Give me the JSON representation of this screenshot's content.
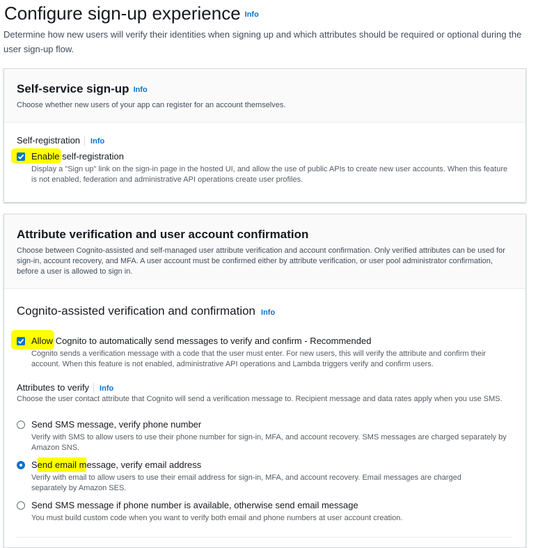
{
  "header": {
    "title": "Configure sign-up experience",
    "info": "Info",
    "description": "Determine how new users will verify their identities when signing up and which attributes should be required or optional during the user sign-up flow."
  },
  "self_service": {
    "title": "Self-service sign-up",
    "info": "Info",
    "description": "Choose whether new users of your app can register for an account themselves.",
    "field_label": "Self-registration",
    "field_info": "Info",
    "checkbox": {
      "label_highlight": "Enable",
      "label_rest": " self-registration",
      "checked": true,
      "description": "Display a \"Sign up\" link on the sign-in page in the hosted UI, and allow the use of public APIs to create new user accounts. When this feature is not enabled, federation and administrative API operations create user profiles."
    }
  },
  "attribute_verification": {
    "title": "Attribute verification and user account confirmation",
    "description": "Choose between Cognito-assisted and self-managed user attribute verification and account confirmation. Only verified attributes can be used for sign-in, account recovery, and MFA. A user account must be confirmed either by attribute verification, or user pool administrator confirmation, before a user is allowed to sign in.",
    "cognito_section": {
      "title": "Cognito-assisted verification and confirmation",
      "info": "Info",
      "checkbox": {
        "label_highlight": "Allow",
        "label_rest": " Cognito to automatically send messages to verify and confirm - Recommended",
        "checked": true,
        "description": "Cognito sends a verification message with a code that the user must enter. For new users, this will verify the attribute and confirm their account. When this feature is not enabled, administrative API operations and Lambda triggers verify and confirm users."
      },
      "attributes_label": "Attributes to verify",
      "attributes_info": "Info",
      "attributes_description": "Choose the user contact attribute that Cognito will send a verification message to. Recipient message and data rates apply when you use SMS.",
      "options": [
        {
          "label": "Send SMS message, verify phone number",
          "description": "Verify with SMS to allow users to use their phone number for sign-in, MFA, and account recovery. SMS messages are charged separately by Amazon SNS.",
          "selected": false
        },
        {
          "label_pre": "S",
          "label_highlight": "end email m",
          "label_post": "essage, verify email address",
          "description": "Verify with email to allow users to use their email address for sign-in, MFA, and account recovery. Email messages are charged separately by Amazon SES.",
          "selected": true
        },
        {
          "label": "Send SMS message if phone number is available, otherwise send email message",
          "description": "You must build custom code when you want to verify both email and phone numbers at user account creation.",
          "selected": false
        }
      ]
    }
  },
  "colors": {
    "accent": "#0972d3",
    "highlight": "#ffff00",
    "text": "#16191f",
    "muted": "#545b64",
    "border": "#d5dbdb"
  }
}
